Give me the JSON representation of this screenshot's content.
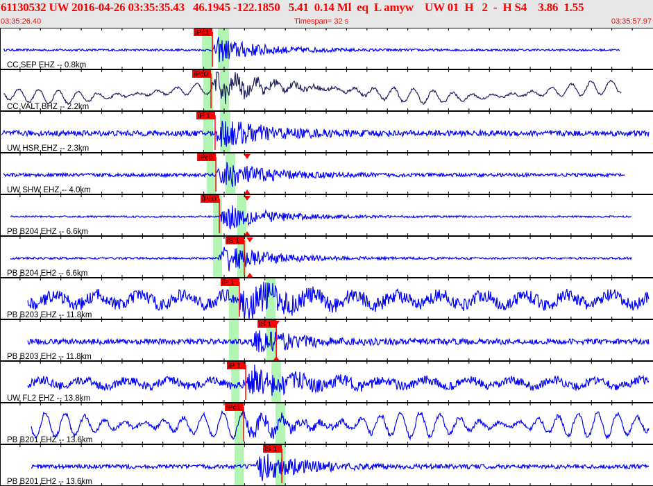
{
  "header": {
    "title": "61130532 UW 2016-04-26 03:35:35.43   46.1945 -122.1850   5.41  0.14 Ml  eq  L amyw    UW 01  H   2  -  H S4    3.86  1.55",
    "start_time": "03:35:26.40",
    "timespan": "Timespan=  32 s",
    "end_time": "03:35:57.97"
  },
  "timespan_s": 32,
  "colors": {
    "accent": "#ff0000",
    "trace": "#0000ff",
    "trace_dark": "#202060",
    "window": "#b3f5b3"
  },
  "traces": [
    {
      "label": "CC SEP EHZ -- 0.8km",
      "color": "#0000ff",
      "start": 0.17,
      "end": 30.37,
      "noise": 1.5,
      "amp": 20,
      "lp": 0,
      "pick": {
        "label": "iPc1",
        "t": 10.41
      },
      "windows": [
        [
          9.9,
          10.41
        ],
        [
          10.68,
          11.22
        ]
      ]
    },
    {
      "label": "CC VALT BHZ -- 2.2km",
      "color": "#202060",
      "start": 0.17,
      "end": 30.44,
      "noise": 1.5,
      "amp": 20,
      "lp": 10,
      "pick": {
        "label": "iPc0",
        "t": 10.34
      },
      "windows": [
        [
          9.96,
          10.44
        ],
        [
          10.78,
          11.22
        ]
      ]
    },
    {
      "label": "UW HSR EHZ -- 2.3km",
      "color": "#0000ff",
      "start": 0.07,
      "end": 31.8,
      "noise": 4,
      "amp": 24,
      "lp": 0,
      "pick": {
        "label": "iP 1",
        "t": 10.54
      },
      "windows": [
        [
          9.96,
          10.44
        ],
        [
          10.78,
          11.29
        ]
      ]
    },
    {
      "label": "UW SHW EHZ -- 4.0km",
      "color": "#0000ff",
      "start": 0.17,
      "end": 30.61,
      "noise": 2.5,
      "amp": 22,
      "lp": 0,
      "pick": {
        "label": "iPc0",
        "t": 10.58
      },
      "s_marker": 12.11,
      "windows": [
        [
          10.13,
          10.58
        ],
        [
          11.05,
          11.53
        ]
      ]
    },
    {
      "label": "PB B204 EHZ -- 6.6km",
      "color": "#0000ff",
      "start": 0.51,
      "end": 30.95,
      "noise": 1.2,
      "amp": 22,
      "lp": 0,
      "pick": {
        "label": "iPc0",
        "t": 10.75
      },
      "s_marker": 12.11,
      "windows": [
        [
          10.44,
          10.88
        ],
        [
          11.63,
          12.07
        ]
      ]
    },
    {
      "label": "PB B204 EH2 -- 6.6km",
      "color": "#0000ff",
      "start": 0.51,
      "end": 30.95,
      "noise": 1.5,
      "amp": 22,
      "lp": 0,
      "pick": {
        "label": "iS 1",
        "t": 11.97
      },
      "s_marker": 12.24,
      "windows": [
        [
          10.44,
          10.88
        ],
        [
          11.63,
          12.07
        ]
      ]
    },
    {
      "label": "PB B203 EHZ -- 11.8km",
      "color": "#0000ff",
      "start": 1.36,
      "end": 31.8,
      "noise": 9,
      "amp": 22,
      "lp": 0,
      "pick": {
        "label": "iP 1",
        "t": 11.73
      },
      "windows": [
        [
          11.22,
          11.7
        ],
        [
          13.03,
          13.5
        ]
      ]
    },
    {
      "label": "PB B203 EH2 -- 11.8km",
      "color": "#0000ff",
      "start": 1.36,
      "end": 31.8,
      "noise": 4,
      "amp": 18,
      "lp": 0,
      "pick": {
        "label": "iS 1",
        "t": 13.54
      },
      "s_marker": 13.54,
      "windows": [
        [
          11.22,
          11.7
        ],
        [
          13.06,
          13.54
        ]
      ]
    },
    {
      "label": "UW FL2 EHZ -- 13.8km",
      "color": "#0000ff",
      "start": 1.36,
      "end": 31.8,
      "noise": 6,
      "amp": 20,
      "lp": 0,
      "pick": {
        "label": "iP 1",
        "t": 12.04
      },
      "windows": [
        [
          11.33,
          11.73
        ],
        [
          13.3,
          13.77
        ]
      ]
    },
    {
      "label": "PB B201 EHZ -- 13.6km",
      "color": "#0000ff",
      "start": 1.53,
      "end": 31.8,
      "noise": 3,
      "amp": 14,
      "lp": 18,
      "pick": {
        "label": "iPc1",
        "t": 11.94
      },
      "windows": [
        [
          11.5,
          11.94
        ],
        [
          13.5,
          13.98
        ]
      ]
    },
    {
      "label": "PB B201 EH2 -- 13.6km",
      "color": "#0000ff",
      "start": 1.53,
      "end": 31.8,
      "noise": 3,
      "amp": 22,
      "lp": 0,
      "pick": {
        "label": "iS 1",
        "t": 13.81
      },
      "windows": [
        [
          11.5,
          11.94
        ],
        [
          13.5,
          13.98
        ]
      ]
    }
  ]
}
